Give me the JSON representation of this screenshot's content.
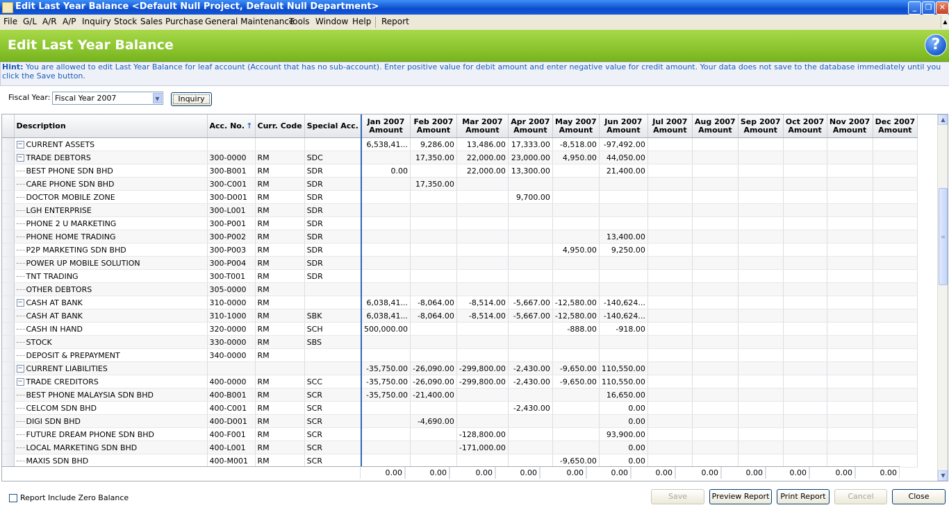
{
  "window": {
    "title": "Edit Last Year Balance <Default Null Project, Default Null Department>"
  },
  "menu": [
    "File",
    "G/L",
    "A/R",
    "A/P",
    "Inquiry",
    "Stock",
    "Sales",
    "Purchase",
    "General Maintenance",
    "Tools",
    "Window",
    "Help",
    "Report"
  ],
  "page": {
    "title": "Edit Last Year Balance",
    "help_icon": "?"
  },
  "hint": {
    "label": "Hint:",
    "text": "You are allowed to edit Last Year Balance for leaf account (Account that has no sub-account). Enter positive value for debit amount and enter negative value for credit amount. Your data does not save to the database immediately until you click the Save button."
  },
  "fiscal": {
    "label": "Fiscal Year:",
    "value": "Fiscal Year 2007",
    "inquiry_label": "Inquiry"
  },
  "grid": {
    "columns": {
      "description": "Description",
      "acc_no": "Acc. No.",
      "curr": "Curr. Code",
      "special": "Special Acc.",
      "sort_indicator": "↑"
    },
    "months": [
      {
        "month": "Jan 2007",
        "sub": "Amount"
      },
      {
        "month": "Feb 2007",
        "sub": "Amount"
      },
      {
        "month": "Mar 2007",
        "sub": "Amount"
      },
      {
        "month": "Apr 2007",
        "sub": "Amount"
      },
      {
        "month": "May 2007",
        "sub": "Amount"
      },
      {
        "month": "Jun 2007",
        "sub": "Amount"
      },
      {
        "month": "Jul 2007",
        "sub": "Amount"
      },
      {
        "month": "Aug 2007",
        "sub": "Amount"
      },
      {
        "month": "Sep 2007",
        "sub": "Amount"
      },
      {
        "month": "Oct 2007",
        "sub": "Amount"
      },
      {
        "month": "Nov 2007",
        "sub": "Amount"
      },
      {
        "month": "Dec 2007",
        "sub": "Amount"
      }
    ],
    "rows": [
      {
        "level": 0,
        "toggle": "−",
        "desc": "CURRENT ASSETS",
        "acc": "",
        "curr": "",
        "special": "",
        "amounts": [
          "6,538,41...",
          "9,286.00",
          "13,486.00",
          "17,333.00",
          "-8,518.00",
          "-97,492.00",
          "",
          "",
          "",
          "",
          "",
          ""
        ]
      },
      {
        "level": 1,
        "toggle": "−",
        "desc": "TRADE DEBTORS",
        "acc": "300-0000",
        "curr": "RM",
        "special": "SDC",
        "amounts": [
          "",
          "17,350.00",
          "22,000.00",
          "23,000.00",
          "4,950.00",
          "44,050.00",
          "",
          "",
          "",
          "",
          "",
          ""
        ]
      },
      {
        "level": 2,
        "toggle": "",
        "desc": "BEST PHONE SDN BHD",
        "acc": "300-B001",
        "curr": "RM",
        "special": "SDR",
        "amounts": [
          "0.00",
          "",
          "22,000.00",
          "13,300.00",
          "",
          "21,400.00",
          "",
          "",
          "",
          "",
          "",
          ""
        ]
      },
      {
        "level": 2,
        "toggle": "",
        "desc": "CARE PHONE SDN BHD",
        "acc": "300-C001",
        "curr": "RM",
        "special": "SDR",
        "amounts": [
          "",
          "17,350.00",
          "",
          "",
          "",
          "",
          "",
          "",
          "",
          "",
          "",
          ""
        ]
      },
      {
        "level": 2,
        "toggle": "",
        "desc": "DOCTOR MOBILE ZONE",
        "acc": "300-D001",
        "curr": "RM",
        "special": "SDR",
        "amounts": [
          "",
          "",
          "",
          "9,700.00",
          "",
          "",
          "",
          "",
          "",
          "",
          "",
          ""
        ]
      },
      {
        "level": 2,
        "toggle": "",
        "desc": "LGH ENTERPRISE",
        "acc": "300-L001",
        "curr": "RM",
        "special": "SDR",
        "amounts": [
          "",
          "",
          "",
          "",
          "",
          "",
          "",
          "",
          "",
          "",
          "",
          ""
        ]
      },
      {
        "level": 2,
        "toggle": "",
        "desc": "PHONE 2 U MARKETING",
        "acc": "300-P001",
        "curr": "RM",
        "special": "SDR",
        "amounts": [
          "",
          "",
          "",
          "",
          "",
          "",
          "",
          "",
          "",
          "",
          "",
          ""
        ]
      },
      {
        "level": 2,
        "toggle": "",
        "desc": "PHONE HOME TRADING",
        "acc": "300-P002",
        "curr": "RM",
        "special": "SDR",
        "amounts": [
          "",
          "",
          "",
          "",
          "",
          "13,400.00",
          "",
          "",
          "",
          "",
          "",
          ""
        ]
      },
      {
        "level": 2,
        "toggle": "",
        "desc": "P2P MARKETING SDN BHD",
        "acc": "300-P003",
        "curr": "RM",
        "special": "SDR",
        "amounts": [
          "",
          "",
          "",
          "",
          "4,950.00",
          "9,250.00",
          "",
          "",
          "",
          "",
          "",
          ""
        ]
      },
      {
        "level": 2,
        "toggle": "",
        "desc": "POWER UP MOBILE SOLUTION",
        "acc": "300-P004",
        "curr": "RM",
        "special": "SDR",
        "amounts": [
          "",
          "",
          "",
          "",
          "",
          "",
          "",
          "",
          "",
          "",
          "",
          ""
        ]
      },
      {
        "level": 2,
        "toggle": "",
        "desc": "TNT TRADING",
        "acc": "300-T001",
        "curr": "RM",
        "special": "SDR",
        "amounts": [
          "",
          "",
          "",
          "",
          "",
          "",
          "",
          "",
          "",
          "",
          "",
          ""
        ]
      },
      {
        "level": 1,
        "toggle": "",
        "desc": "OTHER DEBTORS",
        "acc": "305-0000",
        "curr": "RM",
        "special": "",
        "amounts": [
          "",
          "",
          "",
          "",
          "",
          "",
          "",
          "",
          "",
          "",
          "",
          ""
        ]
      },
      {
        "level": 1,
        "toggle": "−",
        "desc": "CASH AT BANK",
        "acc": "310-0000",
        "curr": "RM",
        "special": "",
        "amounts": [
          "6,038,41...",
          "-8,064.00",
          "-8,514.00",
          "-5,667.00",
          "-12,580.00",
          "-140,624...",
          "",
          "",
          "",
          "",
          "",
          ""
        ]
      },
      {
        "level": 2,
        "toggle": "",
        "desc": "CASH AT BANK",
        "acc": "310-1000",
        "curr": "RM",
        "special": "SBK",
        "amounts": [
          "6,038,41...",
          "-8,064.00",
          "-8,514.00",
          "-5,667.00",
          "-12,580.00",
          "-140,624...",
          "",
          "",
          "",
          "",
          "",
          ""
        ]
      },
      {
        "level": 1,
        "toggle": "",
        "desc": "CASH IN HAND",
        "acc": "320-0000",
        "curr": "RM",
        "special": "SCH",
        "amounts": [
          "500,000.00",
          "",
          "",
          "",
          "-888.00",
          "-918.00",
          "",
          "",
          "",
          "",
          "",
          ""
        ]
      },
      {
        "level": 1,
        "toggle": "",
        "desc": "STOCK",
        "acc": "330-0000",
        "curr": "RM",
        "special": "SBS",
        "amounts": [
          "",
          "",
          "",
          "",
          "",
          "",
          "",
          "",
          "",
          "",
          "",
          ""
        ]
      },
      {
        "level": 1,
        "toggle": "",
        "desc": "DEPOSIT & PREPAYMENT",
        "acc": "340-0000",
        "curr": "RM",
        "special": "",
        "amounts": [
          "",
          "",
          "",
          "",
          "",
          "",
          "",
          "",
          "",
          "",
          "",
          ""
        ]
      },
      {
        "level": 0,
        "toggle": "−",
        "desc": "CURRENT LIABILITIES",
        "acc": "",
        "curr": "",
        "special": "",
        "amounts": [
          "-35,750.00",
          "-26,090.00",
          "-299,800.00",
          "-2,430.00",
          "-9,650.00",
          "110,550.00",
          "",
          "",
          "",
          "",
          "",
          ""
        ]
      },
      {
        "level": 1,
        "toggle": "−",
        "desc": "TRADE CREDITORS",
        "acc": "400-0000",
        "curr": "RM",
        "special": "SCC",
        "amounts": [
          "-35,750.00",
          "-26,090.00",
          "-299,800.00",
          "-2,430.00",
          "-9,650.00",
          "110,550.00",
          "",
          "",
          "",
          "",
          "",
          ""
        ]
      },
      {
        "level": 2,
        "toggle": "",
        "desc": "BEST PHONE MALAYSIA SDN BHD",
        "acc": "400-B001",
        "curr": "RM",
        "special": "SCR",
        "amounts": [
          "-35,750.00",
          "-21,400.00",
          "",
          "",
          "",
          "16,650.00",
          "",
          "",
          "",
          "",
          "",
          ""
        ]
      },
      {
        "level": 2,
        "toggle": "",
        "desc": "CELCOM SDN BHD",
        "acc": "400-C001",
        "curr": "RM",
        "special": "SCR",
        "amounts": [
          "",
          "",
          "",
          "-2,430.00",
          "",
          "0.00",
          "",
          "",
          "",
          "",
          "",
          ""
        ]
      },
      {
        "level": 2,
        "toggle": "",
        "desc": "DIGI SDN BHD",
        "acc": "400-D001",
        "curr": "RM",
        "special": "SCR",
        "amounts": [
          "",
          "-4,690.00",
          "",
          "",
          "",
          "0.00",
          "",
          "",
          "",
          "",
          "",
          ""
        ]
      },
      {
        "level": 2,
        "toggle": "",
        "desc": "FUTURE DREAM PHONE SDN BHD",
        "acc": "400-F001",
        "curr": "RM",
        "special": "SCR",
        "amounts": [
          "",
          "",
          "-128,800.00",
          "",
          "",
          "93,900.00",
          "",
          "",
          "",
          "",
          "",
          ""
        ]
      },
      {
        "level": 2,
        "toggle": "",
        "desc": "LOCAL MARKETING SDN BHD",
        "acc": "400-L001",
        "curr": "RM",
        "special": "SCR",
        "amounts": [
          "",
          "",
          "-171,000.00",
          "",
          "",
          "0.00",
          "",
          "",
          "",
          "",
          "",
          ""
        ]
      },
      {
        "level": 2,
        "toggle": "",
        "desc": "MAXIS SDN BHD",
        "acc": "400-M001",
        "curr": "RM",
        "special": "SCR",
        "amounts": [
          "",
          "",
          "",
          "",
          "-9,650.00",
          "0.00",
          "",
          "",
          "",
          "",
          "",
          ""
        ]
      }
    ],
    "totals": [
      "0.00",
      "0.00",
      "0.00",
      "0.00",
      "0.00",
      "0.00",
      "0.00",
      "0.00",
      "0.00",
      "0.00",
      "0.00",
      "0.00"
    ]
  },
  "footer": {
    "include_zero_label": "Report Include Zero Balance",
    "save": "Save",
    "preview": "Preview Report",
    "print": "Print Report",
    "cancel": "Cancel",
    "close": "Close"
  }
}
